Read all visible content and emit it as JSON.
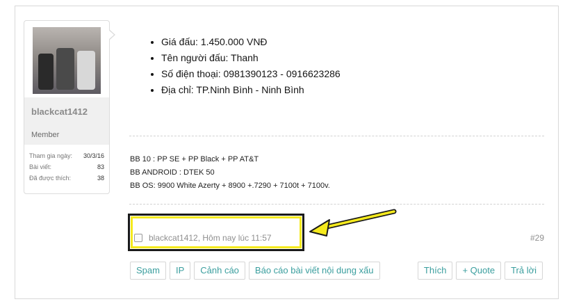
{
  "user": {
    "name": "blackcat1412",
    "title": "Member",
    "stats": [
      {
        "label": "Tham gia ngày:",
        "value": "30/3/16"
      },
      {
        "label": "Bài viết:",
        "value": "83"
      },
      {
        "label": "Đã được thích:",
        "value": "38"
      }
    ]
  },
  "post": {
    "bullets": [
      "Giá đấu: 1.450.000 VNĐ",
      "Tên người đấu: Thanh",
      "Số điện thoại: 0981390123 - 0916623286",
      "Địa chỉ: TP.Ninh Bình - Ninh Bình"
    ],
    "signature": [
      "BB 10 : PP SE + PP Black + PP AT&T",
      "BB ANDROID : DTEK 50",
      "BB OS: 9900 White Azerty + 8900 +.7290 + 7100t + 7100v."
    ],
    "meta": "blackcat1412, Hôm nay lúc 11:57",
    "number": "#29"
  },
  "actions_left": [
    "Spam",
    "IP",
    "Cảnh cáo",
    "Báo cáo bài viết nội dung xấu"
  ],
  "actions_right": [
    "Thích",
    "+ Quote",
    "Trả lời"
  ],
  "colors": {
    "link": "#3a9e9e",
    "highlight": "#f5ea1d",
    "highlight_border": "#1a1a1a"
  }
}
